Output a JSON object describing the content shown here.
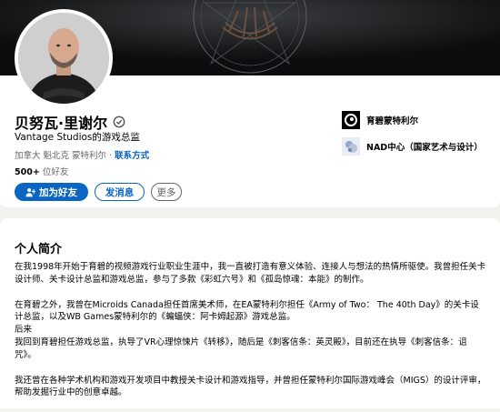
{
  "profile": {
    "name": "贝努瓦·里谢尔",
    "headline": "Vantage Studios的游戏总监",
    "location": "加拿大 魁北克 蒙特利尔 · ",
    "contact_link": "联系方式",
    "connections_count": "500+",
    "connections_label": " 位好友"
  },
  "actions": {
    "connect": "加为好友",
    "message": "发消息",
    "more": "更多"
  },
  "side": {
    "items": [
      {
        "label": "育碧蒙特利尔",
        "icon": "ubisoft-logo-icon"
      },
      {
        "label": "NAD中心（国家艺术与设计）",
        "icon": "nad-logo-icon"
      }
    ]
  },
  "about": {
    "title": "个人简介",
    "p1": "在我1998年开始于育碧的视频游戏行业职业生涯中，我一直被打造有意义体验、连接人与想法的热情所驱使。我曾担任关卡设计师、关卡设计总监和游戏总监，参与了多款《彩虹六号》和《孤岛惊魂：本能》的制作。",
    "p2a": "在育碧之外，我曾在Microids Canada担任首席美术师，在EA蒙特利尔担任《Army of Two： The 40th Day》的关卡设计总监，以及WB Games蒙特利尔的《蝙蝠侠：阿卡姆起源》游戏总监。",
    "p2b": "后来",
    "p2c": "我回到育碧担任游戏总监，执导了VR心理惊悚片《转移》，随后是《刺客信条：英灵殿》，目前还在执导《刺客信条：诅咒》。",
    "p3": "我还曾在各种学术机构和游戏开发项目中教授关卡设计和游戏指导，并曾担任蒙特利尔国际游戏峰会（MIGS）的设计评审，帮助发掘行业中的创意卓越。"
  },
  "colors": {
    "accent": "#0a66c2",
    "page_bg": "#f3f2ef"
  }
}
